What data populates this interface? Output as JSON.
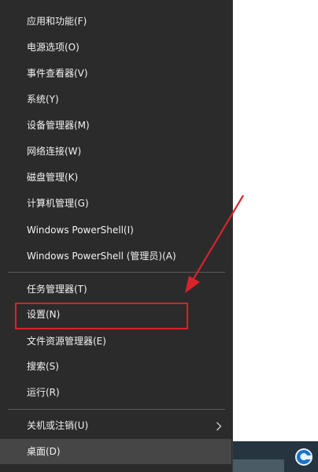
{
  "menu": {
    "items": [
      {
        "label": "应用和功能(F)"
      },
      {
        "label": "电源选项(O)"
      },
      {
        "label": "事件查看器(V)"
      },
      {
        "label": "系统(Y)"
      },
      {
        "label": "设备管理器(M)"
      },
      {
        "label": "网络连接(W)"
      },
      {
        "label": "磁盘管理(K)"
      },
      {
        "label": "计算机管理(G)"
      },
      {
        "label": "Windows PowerShell(I)"
      },
      {
        "label": "Windows PowerShell (管理员)(A)"
      },
      {
        "label": "任务管理器(T)"
      },
      {
        "label": "设置(N)",
        "highlighted": true
      },
      {
        "label": "文件资源管理器(E)"
      },
      {
        "label": "搜索(S)"
      },
      {
        "label": "运行(R)"
      },
      {
        "label": "关机或注销(U)",
        "has_submenu": true,
        "submenu_arrow_icon": "chevron-right-icon"
      },
      {
        "label": "桌面(D)",
        "state": "hovered"
      }
    ]
  },
  "annotation": {
    "highlight_color": "#d9232b",
    "arrow_color": "#d9232b"
  },
  "taskbar": {
    "tray_icon": "browser-icon"
  }
}
